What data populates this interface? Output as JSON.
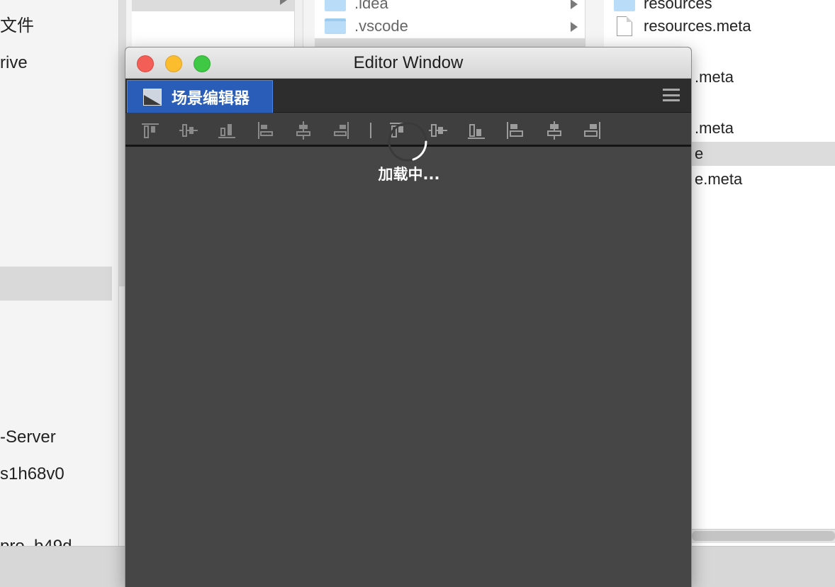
{
  "sidebar": {
    "items": [
      "文件",
      "rive",
      "-Server",
      "s1h68v0",
      "pro_b49d"
    ]
  },
  "finder": {
    "column2": [
      {
        "label": ".idea",
        "type": "folder"
      },
      {
        "label": ".vscode",
        "type": "folder"
      }
    ],
    "column3": [
      {
        "label": "resources",
        "type": "folder"
      },
      {
        "label": "resources.meta",
        "type": "file"
      }
    ],
    "peek_items": [
      ".meta",
      ".meta",
      "e",
      "e.meta"
    ]
  },
  "window": {
    "title": "Editor Window",
    "tab_label": "场景编辑器",
    "loading_text": "加载中...",
    "toolbar_tools": [
      "align-top-icon",
      "align-v-center-icon",
      "align-bottom-icon",
      "align-left-icon",
      "align-h-center-icon",
      "align-right-icon",
      "distribute-top-icon",
      "distribute-v-center-icon",
      "distribute-bottom-icon",
      "distribute-left-icon",
      "distribute-h-center-icon",
      "distribute-right-icon"
    ]
  },
  "colors": {
    "tab_active": "#2a5db8",
    "editor_bg": "#464646",
    "tabbar_bg": "#2d2d2d"
  }
}
